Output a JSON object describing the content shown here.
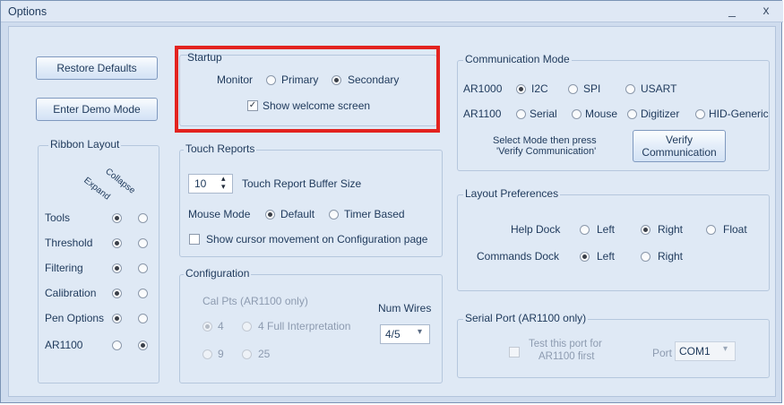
{
  "window": {
    "title": "Options",
    "minimize_glyph": "_",
    "close_glyph": "x"
  },
  "buttons": {
    "restore_defaults": "Restore Defaults",
    "enter_demo_mode": "Enter Demo Mode",
    "verify_communication_line1": "Verify",
    "verify_communication_line2": "Communication"
  },
  "ribbon_layout": {
    "title": "Ribbon Layout",
    "col_expand": "Expand",
    "col_collapse": "Collapse",
    "rows": [
      {
        "label": "Tools",
        "selected": "expand"
      },
      {
        "label": "Threshold",
        "selected": "expand"
      },
      {
        "label": "Filtering",
        "selected": "expand"
      },
      {
        "label": "Calibration",
        "selected": "expand"
      },
      {
        "label": "Pen Options",
        "selected": "expand"
      },
      {
        "label": "AR1100",
        "selected": "collapse"
      }
    ]
  },
  "startup": {
    "title": "Startup",
    "monitor_label": "Monitor",
    "primary": "Primary",
    "secondary": "Secondary",
    "monitor_selected": "secondary",
    "show_welcome": "Show welcome screen",
    "show_welcome_checked": true,
    "check_glyph": "✓"
  },
  "touch_reports": {
    "title": "Touch Reports",
    "buffer_value": "10",
    "buffer_label": "Touch Report Buffer Size",
    "mouse_mode_label": "Mouse Mode",
    "default": "Default",
    "timer_based": "Timer Based",
    "mouse_mode_selected": "default",
    "show_cursor": "Show cursor movement on Configuration page",
    "show_cursor_checked": false
  },
  "configuration": {
    "title": "Configuration",
    "cal_pts_label": "Cal Pts (AR1100 only)",
    "opt_4": "4",
    "opt_4_full": "4 Full Interpretation",
    "opt_9": "9",
    "opt_25": "25",
    "cal_selected": "4",
    "num_wires_label": "Num Wires",
    "num_wires_value": "4/5"
  },
  "communication_mode": {
    "title": "Communication Mode",
    "ar1000_label": "AR1000",
    "ar1000_options": [
      "I2C",
      "SPI",
      "USART"
    ],
    "ar1000_selected": "I2C",
    "ar1100_label": "AR1100",
    "ar1100_options": [
      "Serial",
      "Mouse",
      "Digitizer",
      "HID-Generic"
    ],
    "ar1100_selected": "",
    "instruction_line1": "Select Mode then press",
    "instruction_line2": "'Verify Communication'"
  },
  "layout_preferences": {
    "title": "Layout Preferences",
    "help_dock_label": "Help Dock",
    "help_options": [
      "Left",
      "Right",
      "Float"
    ],
    "help_selected": "Right",
    "commands_dock_label": "Commands Dock",
    "commands_options": [
      "Left",
      "Right"
    ],
    "commands_selected": "Left"
  },
  "serial_port": {
    "title": "Serial Port (AR1100 only)",
    "test_line1": "Test this port for",
    "test_line2": "AR1100 first",
    "port_label": "Port",
    "port_value": "COM1"
  },
  "glyphs": {
    "dropdown_arrow": "▾",
    "spin_up": "▴",
    "spin_down": "▾"
  },
  "colors": {
    "highlight_border": "#e3231f",
    "accent": "#1e395b"
  }
}
